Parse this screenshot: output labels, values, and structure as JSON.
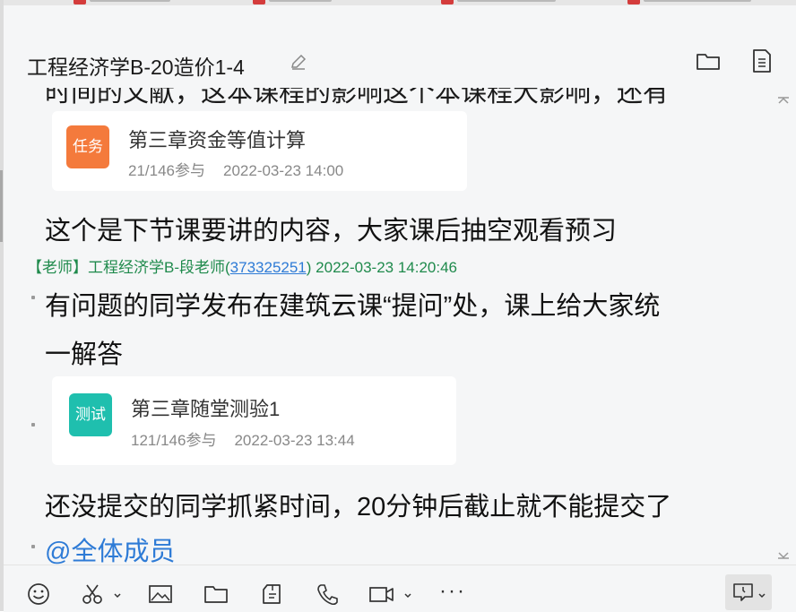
{
  "header": {
    "title": "工程经济学B-20造价1-4",
    "icons": [
      "edit-icon",
      "folder-icon",
      "notes-icon"
    ]
  },
  "messages": {
    "clipped_line": "时间的文献，这本课程的影响这个本课程大影响，还有",
    "task_card": {
      "badge": "任务",
      "badge_color": "#f47a3c",
      "title": "第三章资金等值计算",
      "participants": "21/146参与",
      "time": "2022-03-23 14:00"
    },
    "preview_note": "这个是下节课要讲的内容，大家课后抽空观看预习",
    "sender": {
      "role": "【老师】",
      "name": "工程经济学B-段老师(",
      "qq": "373325251",
      "close": ")",
      "time": " 2022-03-23 14:20:46"
    },
    "question_line1": "有问题的同学发布在建筑云课“提问”处，课上给大家统",
    "question_line2": "一解答",
    "quiz_card": {
      "badge": "测试",
      "badge_color": "#1fbfae",
      "title": "第三章随堂测验1",
      "participants": "121/146参与",
      "time": "2022-03-23 13:44"
    },
    "deadline_note": "还没提交的同学抓紧时间，20分钟后截止就不能提交了",
    "mention": "@全体成员"
  },
  "toolbar": {
    "icons": [
      "emoji-icon",
      "scissors-icon",
      "image-icon",
      "folder-icon",
      "file-share-icon",
      "phone-icon",
      "video-icon",
      "more-icon",
      "history-icon"
    ],
    "more_label": "···"
  },
  "colors": {
    "background": "#f5f6f7",
    "sender": "#1f8a4c",
    "link": "#2e7bd6"
  }
}
